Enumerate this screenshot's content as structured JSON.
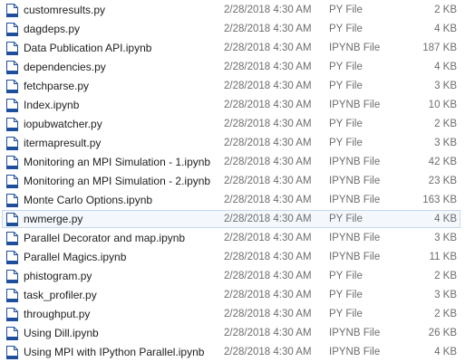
{
  "files": [
    {
      "name": "customresults.py",
      "date": "2/28/2018 4:30 AM",
      "type": "PY File",
      "size": "2 KB"
    },
    {
      "name": "dagdeps.py",
      "date": "2/28/2018 4:30 AM",
      "type": "PY File",
      "size": "4 KB"
    },
    {
      "name": "Data Publication API.ipynb",
      "date": "2/28/2018 4:30 AM",
      "type": "IPYNB File",
      "size": "187 KB"
    },
    {
      "name": "dependencies.py",
      "date": "2/28/2018 4:30 AM",
      "type": "PY File",
      "size": "4 KB"
    },
    {
      "name": "fetchparse.py",
      "date": "2/28/2018 4:30 AM",
      "type": "PY File",
      "size": "3 KB"
    },
    {
      "name": "Index.ipynb",
      "date": "2/28/2018 4:30 AM",
      "type": "IPYNB File",
      "size": "10 KB"
    },
    {
      "name": "iopubwatcher.py",
      "date": "2/28/2018 4:30 AM",
      "type": "PY File",
      "size": "2 KB"
    },
    {
      "name": "itermapresult.py",
      "date": "2/28/2018 4:30 AM",
      "type": "PY File",
      "size": "3 KB"
    },
    {
      "name": "Monitoring an MPI Simulation - 1.ipynb",
      "date": "2/28/2018 4:30 AM",
      "type": "IPYNB File",
      "size": "42 KB"
    },
    {
      "name": "Monitoring an MPI Simulation - 2.ipynb",
      "date": "2/28/2018 4:30 AM",
      "type": "IPYNB File",
      "size": "23 KB"
    },
    {
      "name": "Monte Carlo Options.ipynb",
      "date": "2/28/2018 4:30 AM",
      "type": "IPYNB File",
      "size": "163 KB"
    },
    {
      "name": "nwmerge.py",
      "date": "2/28/2018 4:30 AM",
      "type": "PY File",
      "size": "4 KB"
    },
    {
      "name": "Parallel Decorator and map.ipynb",
      "date": "2/28/2018 4:30 AM",
      "type": "IPYNB File",
      "size": "3 KB"
    },
    {
      "name": "Parallel Magics.ipynb",
      "date": "2/28/2018 4:30 AM",
      "type": "IPYNB File",
      "size": "11 KB"
    },
    {
      "name": "phistogram.py",
      "date": "2/28/2018 4:30 AM",
      "type": "PY File",
      "size": "2 KB"
    },
    {
      "name": "task_profiler.py",
      "date": "2/28/2018 4:30 AM",
      "type": "PY File",
      "size": "3 KB"
    },
    {
      "name": "throughput.py",
      "date": "2/28/2018 4:30 AM",
      "type": "PY File",
      "size": "2 KB"
    },
    {
      "name": "Using Dill.ipynb",
      "date": "2/28/2018 4:30 AM",
      "type": "IPYNB File",
      "size": "26 KB"
    },
    {
      "name": "Using MPI with IPython Parallel.ipynb",
      "date": "2/28/2018 4:30 AM",
      "type": "IPYNB File",
      "size": "4 KB"
    }
  ],
  "focused_index": 11,
  "icon": "generic-file-icon",
  "colors": {
    "name_text": "#1e1e1e",
    "detail_text": "#6d6d6d",
    "focus_border": "#c6d8ee",
    "icon_blue": "#1e4f9c"
  }
}
